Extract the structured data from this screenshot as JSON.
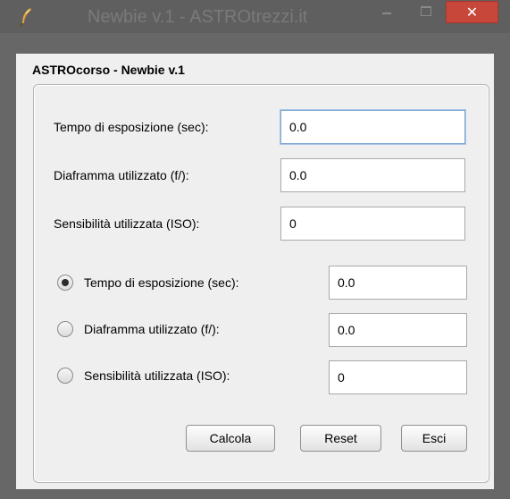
{
  "window": {
    "title": "Newbie v.1 - ASTROtrezzi.it",
    "icons": {
      "app": "feather-icon",
      "minimize": "minimize-icon",
      "maximize": "maximize-icon",
      "close": "close-icon"
    },
    "colors": {
      "titlebar": "#5f5f5f",
      "close_button": "#c7483b",
      "panel": "#efefef"
    }
  },
  "panel": {
    "title": "ASTROcorso - Newbie v.1"
  },
  "inputs": [
    {
      "label": "Tempo di esposizione (sec):",
      "value": "0.0"
    },
    {
      "label": "Diaframma utilizzato (f/):",
      "value": "0.0"
    },
    {
      "label": "Sensibilità utilizzata (ISO):",
      "value": "0"
    }
  ],
  "results": [
    {
      "label": "Tempo di esposizione (sec):",
      "value": "0.0",
      "selected": true
    },
    {
      "label": "Diaframma utilizzato (f/):",
      "value": "0.0",
      "selected": false
    },
    {
      "label": "Sensibilità utilizzata (ISO):",
      "value": "0",
      "selected": false
    }
  ],
  "buttons": {
    "calcola": "Calcola",
    "reset": "Reset",
    "esci": "Esci"
  }
}
